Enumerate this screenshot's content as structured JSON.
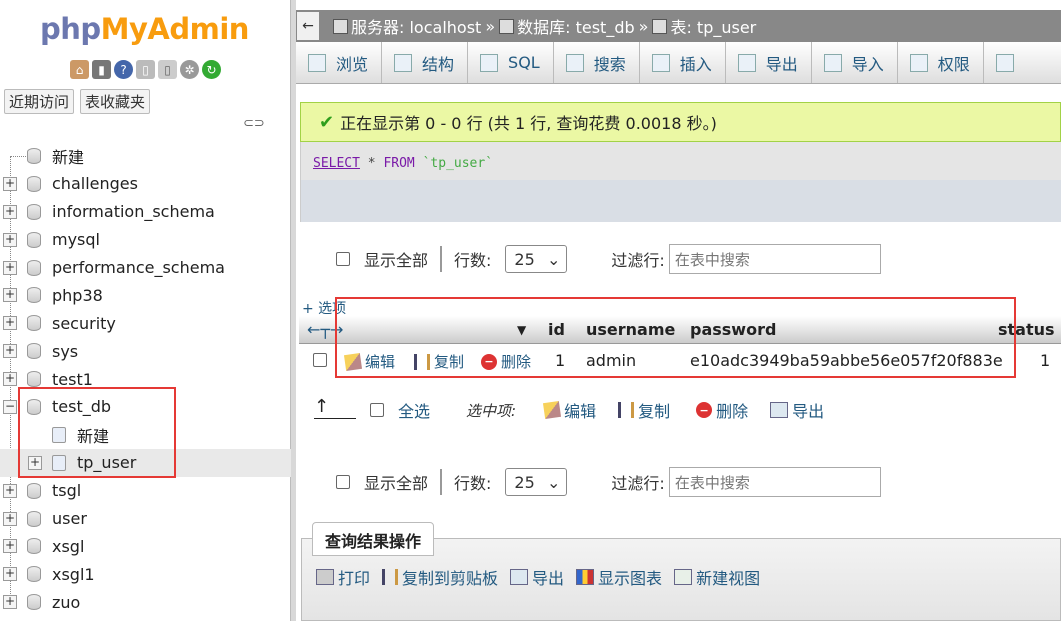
{
  "nav": {
    "logo_part1": "php",
    "logo_part2": "MyAdmin",
    "tabs": [
      "近期访问",
      "表收藏夹"
    ],
    "new_label": "新建",
    "databases": [
      "challenges",
      "information_schema",
      "mysql",
      "performance_schema",
      "php38",
      "security",
      "sys",
      "test1",
      "test_db",
      "tsgl",
      "user",
      "xsgl",
      "xsgl1",
      "zuo"
    ],
    "test_db_children": {
      "new_label": "新建",
      "table": "tp_user"
    }
  },
  "breadcrumb": {
    "server": "服务器: localhost",
    "sep1": "»",
    "database": "数据库: test_db",
    "sep2": "»",
    "table": "表: tp_user"
  },
  "menu": [
    "浏览",
    "结构",
    "SQL",
    "搜索",
    "插入",
    "导出",
    "导入",
    "权限"
  ],
  "result": {
    "message": "正在显示第 0 - 0 行 (共 1 行, 查询花费 0.0018 秒。)",
    "sql": {
      "select": "SELECT",
      "star": " * ",
      "from": "FROM",
      "table": " `tp_user`"
    }
  },
  "controls": {
    "show_all": "显示全部",
    "rows_label": "行数:",
    "rows_value": "25",
    "filter_label": "过滤行:",
    "filter_placeholder": "在表中搜索"
  },
  "options_link": "+ 选项",
  "table": {
    "columns": [
      "id",
      "username",
      "password",
      "status"
    ],
    "row": {
      "edit": "编辑",
      "copy": "复制",
      "delete": "删除",
      "id": "1",
      "username": "admin",
      "password": "e10adc3949ba59abbe56e057f20f883e",
      "status": "1"
    }
  },
  "bulk": {
    "select_all": "全选",
    "with_selected": "选中项:",
    "edit": "编辑",
    "copy": "复制",
    "delete": "删除",
    "export": "导出"
  },
  "ops": {
    "legend": "查询结果操作",
    "items": [
      "打印",
      "复制到剪贴板",
      "导出",
      "显示图表",
      "新建视图"
    ]
  }
}
